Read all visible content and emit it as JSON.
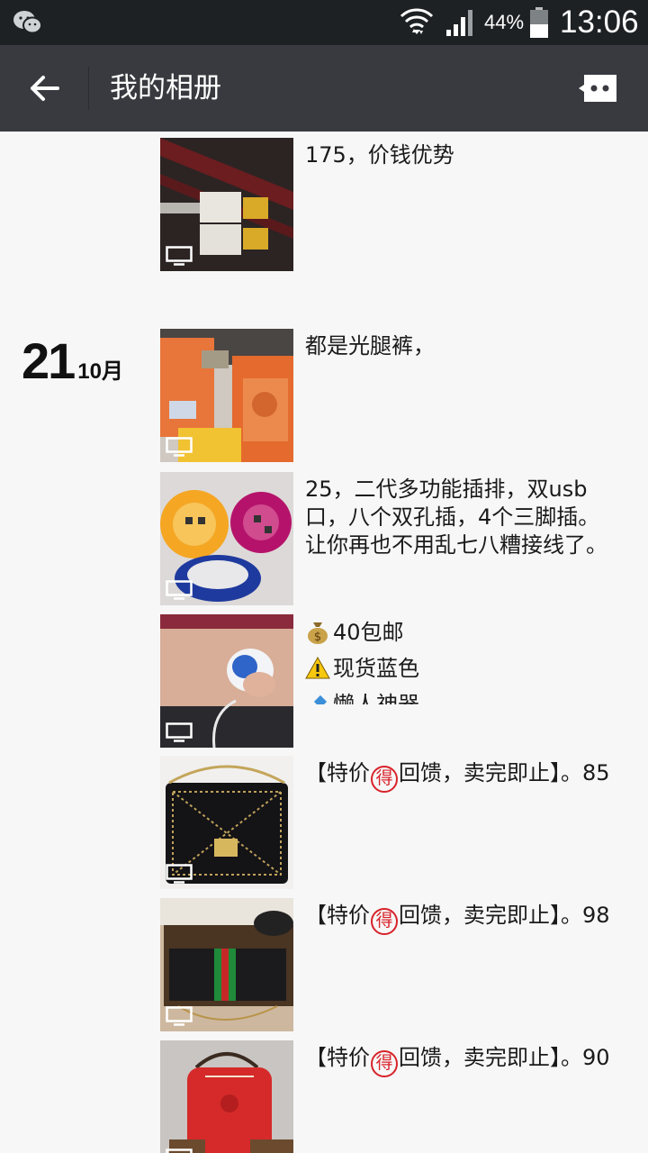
{
  "status_bar": {
    "battery_percent": "44%",
    "time": "13:06",
    "icons": [
      "wechat-icon",
      "wifi-icon",
      "signal-icon",
      "battery-icon"
    ]
  },
  "header": {
    "title": "我的相册",
    "back_icon": "arrow-left-icon",
    "message_icon": "message-bubble-icon"
  },
  "date_group": {
    "day": "21",
    "month": "10月"
  },
  "posts": [
    {
      "text": "175，价钱优势",
      "has_video_icon": true
    },
    {
      "text": "都是光腿裤，",
      "has_video_icon": true
    },
    {
      "text": "25，二代多功能插排，双usb口，八个双孔插，4个三脚插。让你再也不用乱七八糟接线了。",
      "has_video_icon": true
    },
    {
      "lines": [
        {
          "emoji": "money-bag-icon",
          "text": "40包邮"
        },
        {
          "emoji": "warning-icon",
          "text": "现货蓝色"
        },
        {
          "emoji": "satellite-icon",
          "text": "懒人神器．。．"
        }
      ],
      "has_video_icon": true
    },
    {
      "text_before": "【特价",
      "badge": "得",
      "text_after": "回馈，卖完即止】。85",
      "has_video_icon": true
    },
    {
      "text_before": "【特价",
      "badge": "得",
      "text_after": "回馈，卖完即止】。98",
      "has_video_icon": true
    },
    {
      "text_before": "【特价",
      "badge": "得",
      "text_after": "回馈，卖完即止】。90",
      "has_video_icon": true
    }
  ],
  "colors": {
    "status_bar_bg": "#1e2124",
    "title_bar_bg": "#393a3f",
    "content_bg": "#f7f7f7",
    "badge_red": "#d8232a"
  }
}
